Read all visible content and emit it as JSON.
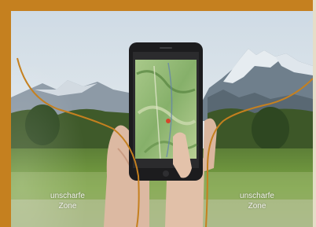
{
  "labels": {
    "left_zone_line1": "unscharfe",
    "left_zone_line2": "Zone",
    "right_zone_line1": "unscharfe",
    "right_zone_line2": "Zone"
  },
  "colors": {
    "frame": "#c5801f",
    "zone_curve": "#c5801f",
    "sky": "#d9e3ea",
    "meadow": "#6f9a3a",
    "phone_body": "#1c1c1e",
    "map_green": "#8fb36b"
  }
}
